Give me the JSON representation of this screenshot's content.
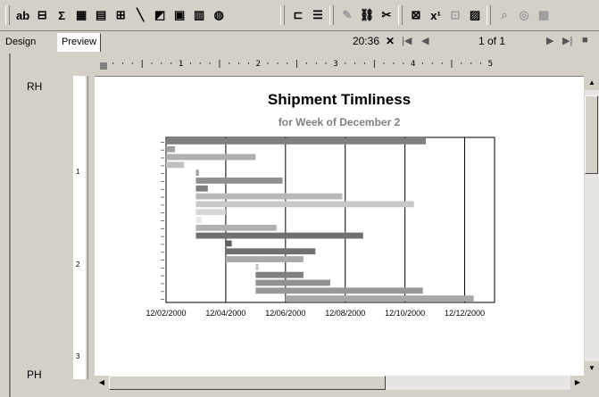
{
  "toolbar": {
    "buttons": [
      {
        "name": "text-box-icon",
        "glyph": "ab",
        "enabled": true
      },
      {
        "name": "list-box-icon",
        "glyph": "⊟",
        "enabled": true
      },
      {
        "name": "sum-icon",
        "glyph": "Σ",
        "enabled": true
      },
      {
        "name": "table-icon",
        "glyph": "▦",
        "enabled": true
      },
      {
        "name": "grid-icon",
        "glyph": "▤",
        "enabled": true
      },
      {
        "name": "subreport-icon",
        "glyph": "⊞",
        "enabled": true
      },
      {
        "name": "line-icon",
        "glyph": "╲",
        "enabled": true
      },
      {
        "name": "shape-icon",
        "glyph": "◩",
        "enabled": true
      },
      {
        "name": "picture-icon",
        "glyph": "▣",
        "enabled": true
      },
      {
        "name": "chart-icon",
        "glyph": "▥",
        "enabled": true
      },
      {
        "name": "map-icon",
        "glyph": "◍",
        "enabled": true
      },
      {
        "name": "group-icon",
        "glyph": "⊏",
        "enabled": true
      },
      {
        "name": "page-break-icon",
        "glyph": "☰",
        "enabled": true
      },
      {
        "name": "pen-icon",
        "glyph": "✎",
        "enabled": false
      },
      {
        "name": "link-icon",
        "glyph": "⛓",
        "enabled": true
      },
      {
        "name": "tools-icon",
        "glyph": "✂",
        "enabled": true
      },
      {
        "name": "query-icon",
        "glyph": "⊠",
        "enabled": true
      },
      {
        "name": "field-icon",
        "glyph": "x¹",
        "enabled": true
      },
      {
        "name": "layout-icon",
        "glyph": "⊡",
        "enabled": false
      },
      {
        "name": "report-icon",
        "glyph": "▨",
        "enabled": true
      },
      {
        "name": "edit-icon",
        "glyph": "⌕",
        "enabled": false
      },
      {
        "name": "search-icon",
        "glyph": "◎",
        "enabled": false
      },
      {
        "name": "settings-icon",
        "glyph": "▩",
        "enabled": false
      }
    ]
  },
  "tabs": {
    "design": "Design",
    "preview": "Preview"
  },
  "status": {
    "time": "20:36",
    "page_info": "1 of 1"
  },
  "bands": {
    "header": "RH",
    "footer": "PH"
  },
  "ruler": {
    "marks": "· · · | · · · 1 · · · | · · · 2 · · · | · · · 3 · · · | · · · 4 · · · | · · · 5"
  },
  "report": {
    "title": "Shipment Timliness",
    "subtitle": "for Week of December 2"
  },
  "chart_data": {
    "type": "bar",
    "orientation": "horizontal-gantt",
    "title": "Shipment Timliness",
    "subtitle": "for Week of December 2",
    "x_ticks": [
      "12/02/2000",
      "12/04/2000",
      "12/06/2000",
      "12/08/2000",
      "12/10/2000",
      "12/12/2000"
    ],
    "x_range_days": [
      0,
      11
    ],
    "tasks": [
      {
        "start": 0.0,
        "end": 8.7,
        "color": "#808080"
      },
      {
        "start": 0.0,
        "end": 0.3,
        "color": "#a0a0a0"
      },
      {
        "start": 0.0,
        "end": 3.0,
        "color": "#b0b0b0"
      },
      {
        "start": 0.0,
        "end": 0.6,
        "color": "#c0c0c0"
      },
      {
        "start": 1.0,
        "end": 1.1,
        "color": "#a0a0a0"
      },
      {
        "start": 1.0,
        "end": 3.9,
        "color": "#909090"
      },
      {
        "start": 1.0,
        "end": 1.4,
        "color": "#808080"
      },
      {
        "start": 1.0,
        "end": 5.9,
        "color": "#b8b8b8"
      },
      {
        "start": 1.0,
        "end": 8.3,
        "color": "#c8c8c8"
      },
      {
        "start": 1.0,
        "end": 2.0,
        "color": "#d8d8d8"
      },
      {
        "start": 1.0,
        "end": 1.2,
        "color": "#e8e8e8"
      },
      {
        "start": 1.0,
        "end": 3.7,
        "color": "#b0b0b0"
      },
      {
        "start": 1.0,
        "end": 6.6,
        "color": "#707070"
      },
      {
        "start": 2.0,
        "end": 2.2,
        "color": "#606060"
      },
      {
        "start": 2.0,
        "end": 5.0,
        "color": "#707070"
      },
      {
        "start": 2.0,
        "end": 4.6,
        "color": "#a8a8a8"
      },
      {
        "start": 3.0,
        "end": 3.1,
        "color": "#c8c8c8"
      },
      {
        "start": 3.0,
        "end": 4.6,
        "color": "#808080"
      },
      {
        "start": 3.0,
        "end": 5.5,
        "color": "#909090"
      },
      {
        "start": 3.0,
        "end": 8.6,
        "color": "#989898"
      },
      {
        "start": 4.0,
        "end": 10.3,
        "color": "#a8a8a8"
      }
    ]
  }
}
